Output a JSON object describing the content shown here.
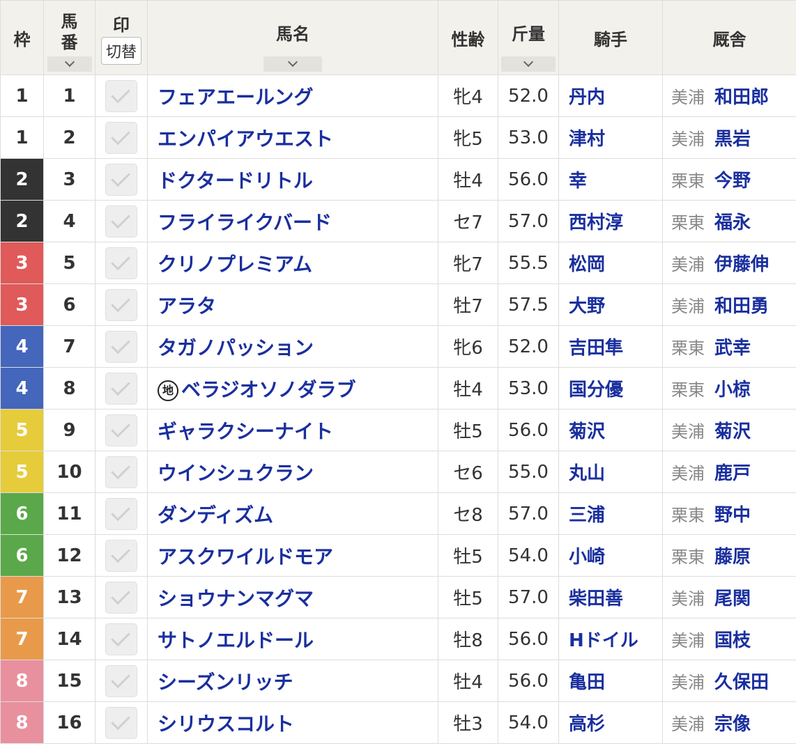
{
  "header": {
    "waku": "枠",
    "umaban_1": "馬",
    "umaban_2": "番",
    "mark": "印",
    "switch": "切替",
    "name": "馬名",
    "sexage": "性齢",
    "weight": "斤量",
    "jockey": "騎手",
    "stable": "厩舎"
  },
  "colors": {
    "waku1": "#ffffff",
    "waku2": "#333333",
    "waku3": "#e05a5a",
    "waku4": "#4466bb",
    "waku5": "#e6cc3a",
    "waku6": "#5aa84a",
    "waku7": "#e89a4a",
    "waku8": "#e8909e",
    "link": "#1a2f9e"
  },
  "rows": [
    {
      "waku": "1",
      "uma": "1",
      "name": "フェアエールング",
      "chi": "",
      "sex": "牝4",
      "wt": "52.0",
      "jockey": "丹内",
      "region": "美浦",
      "trainer": "和田郎"
    },
    {
      "waku": "1",
      "uma": "2",
      "name": "エンパイアウエスト",
      "chi": "",
      "sex": "牝5",
      "wt": "53.0",
      "jockey": "津村",
      "region": "美浦",
      "trainer": "黒岩"
    },
    {
      "waku": "2",
      "uma": "3",
      "name": "ドクタードリトル",
      "chi": "",
      "sex": "牡4",
      "wt": "56.0",
      "jockey": "幸",
      "region": "栗東",
      "trainer": "今野"
    },
    {
      "waku": "2",
      "uma": "4",
      "name": "フライライクバード",
      "chi": "",
      "sex": "セ7",
      "wt": "57.0",
      "jockey": "西村淳",
      "region": "栗東",
      "trainer": "福永"
    },
    {
      "waku": "3",
      "uma": "5",
      "name": "クリノプレミアム",
      "chi": "",
      "sex": "牝7",
      "wt": "55.5",
      "jockey": "松岡",
      "region": "美浦",
      "trainer": "伊藤伸"
    },
    {
      "waku": "3",
      "uma": "6",
      "name": "アラタ",
      "chi": "",
      "sex": "牡7",
      "wt": "57.5",
      "jockey": "大野",
      "region": "美浦",
      "trainer": "和田勇"
    },
    {
      "waku": "4",
      "uma": "7",
      "name": "タガノパッション",
      "chi": "",
      "sex": "牝6",
      "wt": "52.0",
      "jockey": "吉田隼",
      "region": "栗東",
      "trainer": "武幸"
    },
    {
      "waku": "4",
      "uma": "8",
      "name": "ベラジオソノダラブ",
      "chi": "地",
      "sex": "牡4",
      "wt": "53.0",
      "jockey": "国分優",
      "region": "栗東",
      "trainer": "小椋"
    },
    {
      "waku": "5",
      "uma": "9",
      "name": "ギャラクシーナイト",
      "chi": "",
      "sex": "牡5",
      "wt": "56.0",
      "jockey": "菊沢",
      "region": "美浦",
      "trainer": "菊沢"
    },
    {
      "waku": "5",
      "uma": "10",
      "name": "ウインシュクラン",
      "chi": "",
      "sex": "セ6",
      "wt": "55.0",
      "jockey": "丸山",
      "region": "美浦",
      "trainer": "鹿戸"
    },
    {
      "waku": "6",
      "uma": "11",
      "name": "ダンディズム",
      "chi": "",
      "sex": "セ8",
      "wt": "57.0",
      "jockey": "三浦",
      "region": "栗東",
      "trainer": "野中"
    },
    {
      "waku": "6",
      "uma": "12",
      "name": "アスクワイルドモア",
      "chi": "",
      "sex": "牡5",
      "wt": "54.0",
      "jockey": "小崎",
      "region": "栗東",
      "trainer": "藤原"
    },
    {
      "waku": "7",
      "uma": "13",
      "name": "ショウナンマグマ",
      "chi": "",
      "sex": "牡5",
      "wt": "57.0",
      "jockey": "柴田善",
      "region": "美浦",
      "trainer": "尾関"
    },
    {
      "waku": "7",
      "uma": "14",
      "name": "サトノエルドール",
      "chi": "",
      "sex": "牡8",
      "wt": "56.0",
      "jockey": "Hドイル",
      "region": "美浦",
      "trainer": "国枝"
    },
    {
      "waku": "8",
      "uma": "15",
      "name": "シーズンリッチ",
      "chi": "",
      "sex": "牡4",
      "wt": "56.0",
      "jockey": "亀田",
      "region": "美浦",
      "trainer": "久保田"
    },
    {
      "waku": "8",
      "uma": "16",
      "name": "シリウスコルト",
      "chi": "",
      "sex": "牡3",
      "wt": "54.0",
      "jockey": "高杉",
      "region": "美浦",
      "trainer": "宗像"
    }
  ]
}
